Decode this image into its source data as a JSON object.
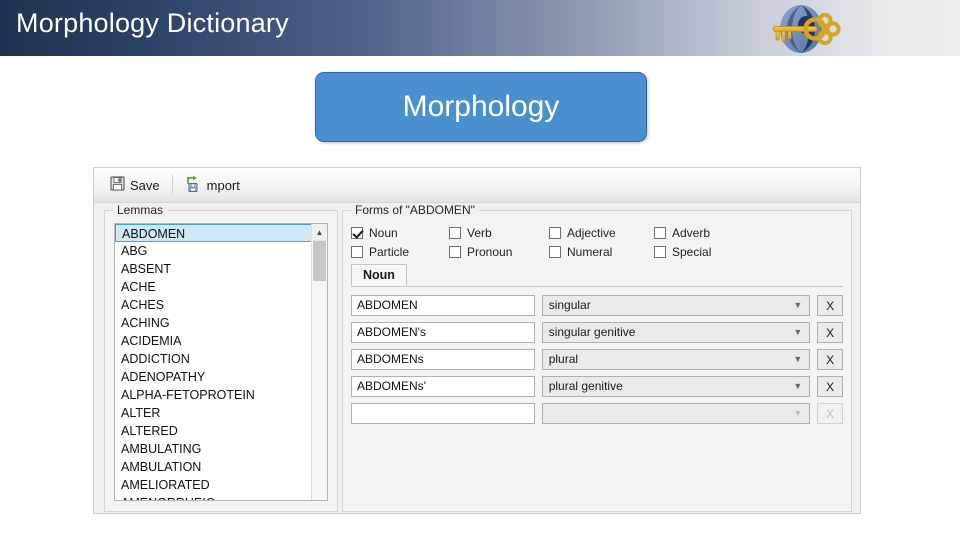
{
  "slide": {
    "title": "Morphology Dictionary",
    "logo_icon": "globe-key-logo",
    "button_label": "Morphology"
  },
  "app": {
    "toolbar": {
      "save_label": "Save",
      "save_icon": "floppy-disk-icon",
      "import_label": "mport",
      "import_icon": "import-arrow-icon"
    },
    "lemmas_panel": {
      "legend": "Lemmas",
      "selected": "ABDOMEN",
      "items": [
        "ABDOMEN",
        "ABG",
        "ABSENT",
        "ACHE",
        "ACHES",
        "ACHING",
        "ACIDEMIA",
        "ADDICTION",
        "ADENOPATHY",
        "ALPHA-FETOPROTEIN",
        "ALTER",
        "ALTERED",
        "AMBULATING",
        "AMBULATION",
        "AMELIORATED",
        "AMENORRHEIC"
      ],
      "scrollbar": {
        "up_arrow_icon": "chevron-up-icon"
      }
    },
    "forms_panel": {
      "legend": "Forms of \"ABDOMEN\"",
      "pos_checkboxes": [
        {
          "label": "Noun",
          "checked": true
        },
        {
          "label": "Verb",
          "checked": false
        },
        {
          "label": "Adjective",
          "checked": false
        },
        {
          "label": "Adverb",
          "checked": false
        },
        {
          "label": "Particle",
          "checked": false
        },
        {
          "label": "Pronoun",
          "checked": false
        },
        {
          "label": "Numeral",
          "checked": false
        },
        {
          "label": "Special",
          "checked": false
        }
      ],
      "tabs": [
        {
          "label": "Noun",
          "active": true
        }
      ],
      "rows": [
        {
          "form": "ABDOMEN",
          "category": "singular",
          "delete_label": "X",
          "enabled": true
        },
        {
          "form": "ABDOMEN's",
          "category": "singular genitive",
          "delete_label": "X",
          "enabled": true
        },
        {
          "form": "ABDOMENs",
          "category": "plural",
          "delete_label": "X",
          "enabled": true
        },
        {
          "form": "ABDOMENs'",
          "category": "plural genitive",
          "delete_label": "X",
          "enabled": true
        },
        {
          "form": "",
          "category": "",
          "delete_label": "X",
          "enabled": false
        }
      ],
      "dropdown_icon": "chevron-down-icon",
      "empty_row_placeholder": ""
    }
  },
  "colors": {
    "title_gradient_start": "#1f3250",
    "title_gradient_end": "#eceef1",
    "button_fill": "#4a90ce",
    "button_border": "#2f6a9e",
    "selection_fill": "#cfe8f5",
    "selection_border": "#4aa2c4"
  }
}
